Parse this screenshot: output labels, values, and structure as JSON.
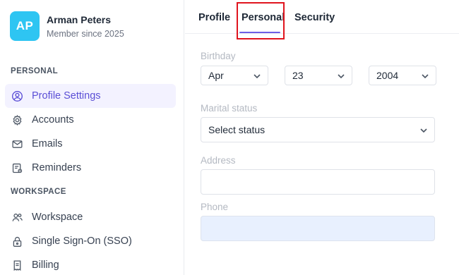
{
  "user": {
    "initials": "AP",
    "name": "Arman Peters",
    "member_since": "Member since 2025"
  },
  "sidebar": {
    "sections": [
      {
        "label": "PERSONAL",
        "items": [
          {
            "label": "Profile Settings",
            "icon": "user-circle-icon",
            "active": true
          },
          {
            "label": "Accounts",
            "icon": "gear-icon",
            "active": false
          },
          {
            "label": "Emails",
            "icon": "mail-icon",
            "active": false
          },
          {
            "label": "Reminders",
            "icon": "reminder-icon",
            "active": false
          }
        ]
      },
      {
        "label": "WORKSPACE",
        "items": [
          {
            "label": "Workspace",
            "icon": "users-icon",
            "active": false
          },
          {
            "label": "Single Sign-On (SSO)",
            "icon": "lock-icon",
            "active": false
          },
          {
            "label": "Billing",
            "icon": "receipt-icon",
            "active": false
          }
        ]
      }
    ]
  },
  "tabs": [
    {
      "label": "Profile",
      "active": false
    },
    {
      "label": "Personal",
      "active": true
    },
    {
      "label": "Security",
      "active": false
    }
  ],
  "form": {
    "birthday": {
      "label": "Birthday",
      "month": "Apr",
      "day": "23",
      "year": "2004"
    },
    "marital_status": {
      "label": "Marital status",
      "value": "Select status"
    },
    "address": {
      "label": "Address",
      "value": ""
    },
    "phone": {
      "label": "Phone",
      "value": ""
    }
  },
  "colors": {
    "accent": "#5b4fd6",
    "avatar_bg": "#2ec5f2",
    "active_nav_bg": "#f3f2ff",
    "highlight_box": "#e0141e"
  }
}
